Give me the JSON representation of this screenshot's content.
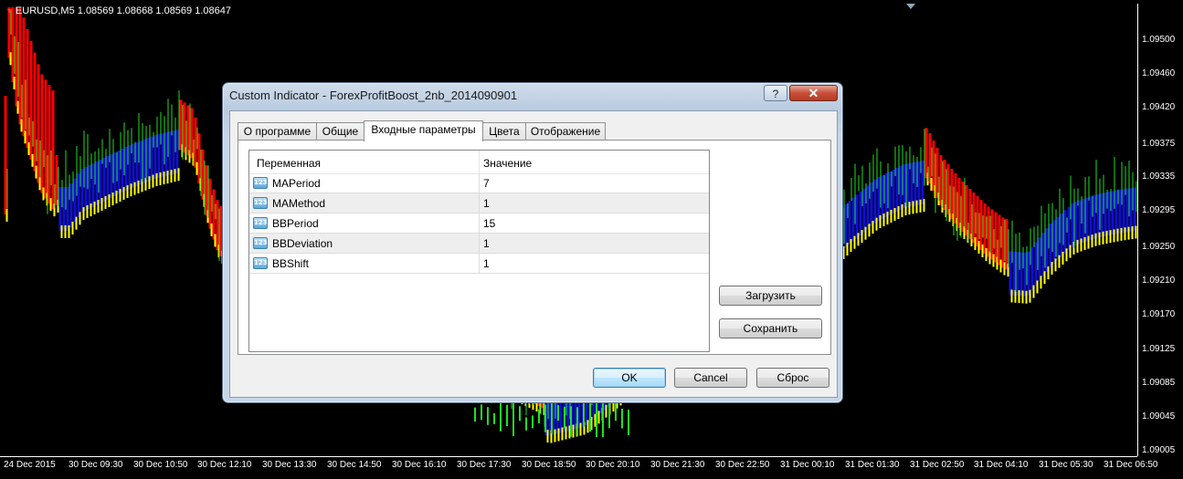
{
  "chart": {
    "symbol_info": "EURUSD,M5  1.08569 1.08668 1.08569 1.08647",
    "price_labels": [
      "1.09500",
      "1.09460",
      "1.09420",
      "1.09375",
      "1.09335",
      "1.09295",
      "1.09250",
      "1.09210",
      "1.09170",
      "1.09125",
      "1.09085",
      "1.09045",
      "1.09005"
    ],
    "time_labels": [
      "24 Dec 2015",
      "30 Dec 09:30",
      "30 Dec 10:50",
      "30 Dec 12:10",
      "30 Dec 13:30",
      "30 Dec 14:50",
      "30 Dec 16:10",
      "30 Dec 17:30",
      "30 Dec 18:50",
      "30 Dec 20:10",
      "30 Dec 21:30",
      "30 Dec 22:50",
      "31 Dec 00:10",
      "31 Dec 01:30",
      "31 Dec 02:50",
      "31 Dec 04:10",
      "31 Dec 05:30",
      "31 Dec 06:50"
    ],
    "colors": {
      "background": "#000000",
      "candles": "#22dd22",
      "up_band": "#ff0000",
      "down_band": "#1010d0",
      "edge": "#ffff00"
    }
  },
  "dialog": {
    "title": "Custom Indicator - ForexProfitBoost_2nb_2014090901",
    "help_label": "?",
    "close_label": "✕",
    "tabs": [
      {
        "label": "О программе"
      },
      {
        "label": "Общие"
      },
      {
        "label": "Входные параметры",
        "active": true
      },
      {
        "label": "Цвета"
      },
      {
        "label": "Отображение"
      }
    ],
    "grid": {
      "col_variable": "Переменная",
      "col_value": "Значение",
      "type_icon_text": "123",
      "rows": [
        {
          "name": "MAPeriod",
          "value": "7"
        },
        {
          "name": "MAMethod",
          "value": "1"
        },
        {
          "name": "BBPeriod",
          "value": "15"
        },
        {
          "name": "BBDeviation",
          "value": "1"
        },
        {
          "name": "BBShift",
          "value": "1"
        }
      ]
    },
    "buttons": {
      "load": "Загрузить",
      "save": "Сохранить",
      "ok": "OK",
      "cancel": "Cancel",
      "reset": "Сброс"
    }
  }
}
